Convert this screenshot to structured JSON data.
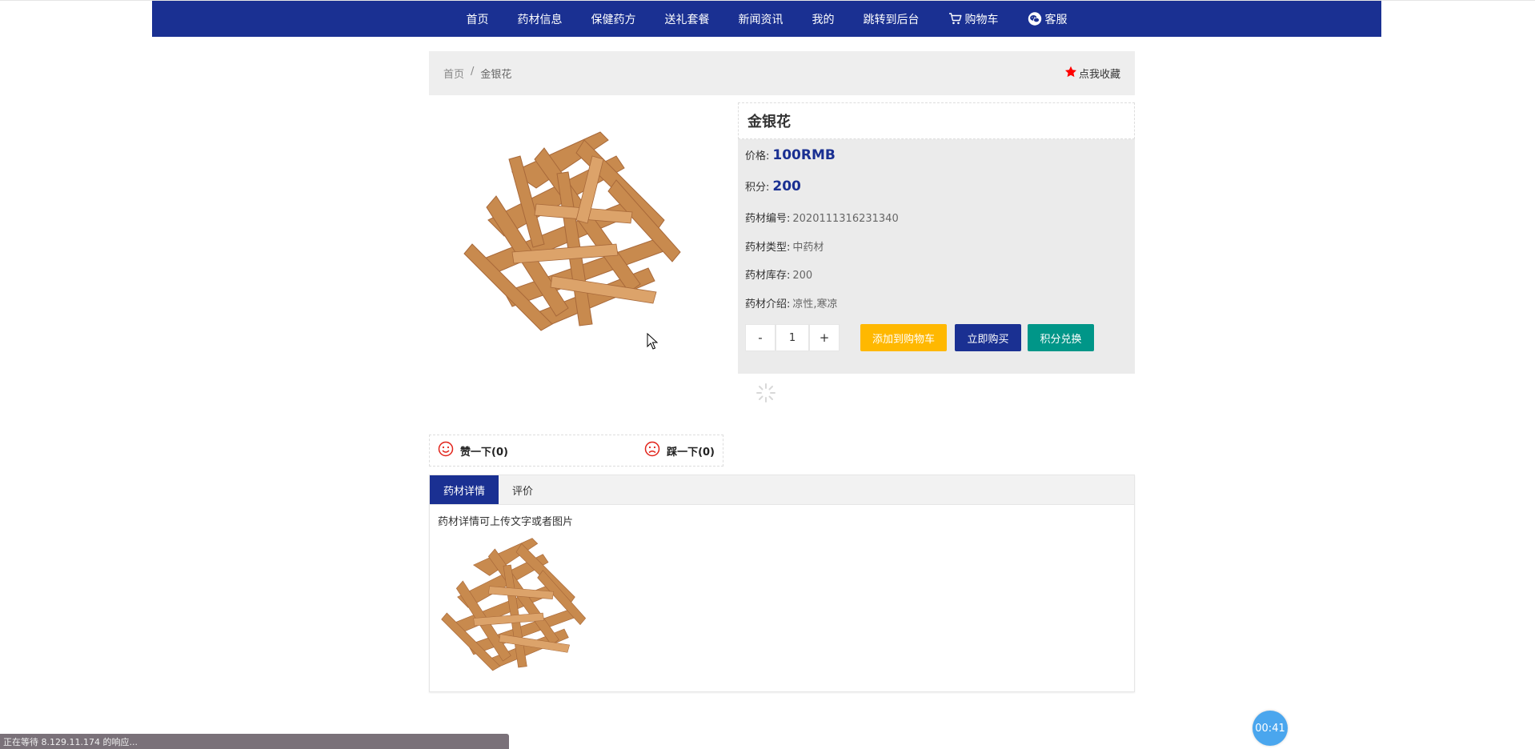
{
  "nav": {
    "items": [
      {
        "label": "首页",
        "name": "nav-home"
      },
      {
        "label": "药材信息",
        "name": "nav-herb-info"
      },
      {
        "label": "保健药方",
        "name": "nav-health-prescription"
      },
      {
        "label": "送礼套餐",
        "name": "nav-gift-package"
      },
      {
        "label": "新闻资讯",
        "name": "nav-news"
      },
      {
        "label": "我的",
        "name": "nav-mine"
      },
      {
        "label": "跳转到后台",
        "name": "nav-admin"
      }
    ],
    "cart_label": "购物车",
    "service_label": "客服"
  },
  "breadcrumb": {
    "home": "首页",
    "separator": "/",
    "current": "金银花"
  },
  "favorite_label": "点我收藏",
  "product": {
    "name": "金银花",
    "price_label": "价格:",
    "price": "100RMB",
    "points_label": "积分:",
    "points": "200",
    "code_label": "药材编号:",
    "code": "2020111316231340",
    "type_label": "药材类型:",
    "type": "中药材",
    "stock_label": "药材库存:",
    "stock": "200",
    "intro_label": "药材介绍:",
    "intro": "凉性,寒凉"
  },
  "quantity": {
    "minus": "-",
    "value": "1",
    "plus": "+"
  },
  "actions": {
    "add_cart": "添加到购物车",
    "buy_now": "立即购买",
    "points_exchange": "积分兑换"
  },
  "votes": {
    "like": "赞一下(0)",
    "dislike": "踩一下(0)"
  },
  "tabs": {
    "detail": "药材详情",
    "review": "评价",
    "detail_text": "药材详情可上传文字或者图片"
  },
  "status_bar": "正在等待 8.129.11.174 的响应...",
  "timer": "00:41",
  "colors": {
    "primary": "#1a3092",
    "cart": "#ffb800",
    "points": "#009688",
    "favorite_star": "#ff0000",
    "vote_icon": "#e2231a"
  }
}
